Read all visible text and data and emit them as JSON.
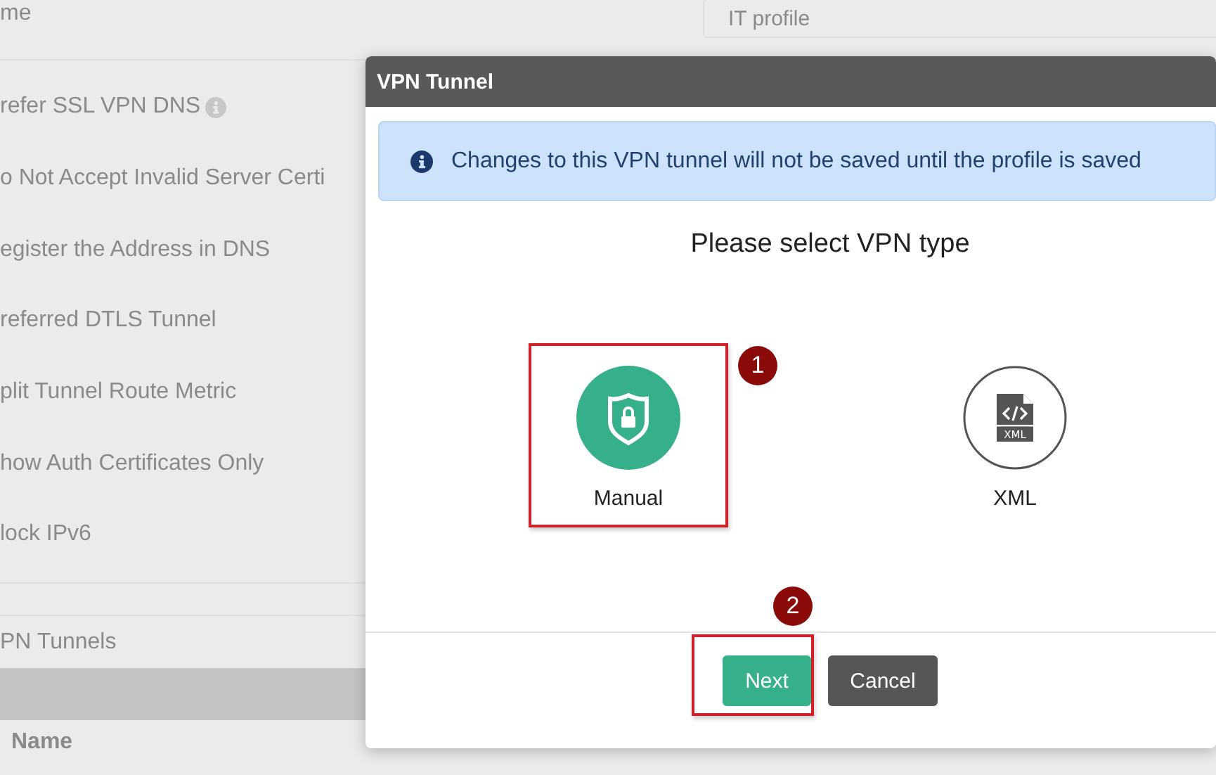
{
  "background": {
    "name_label": "me",
    "profile_field": {
      "value": "IT profile"
    },
    "settings": [
      {
        "label": "refer SSL VPN DNS",
        "info": true
      },
      {
        "label": "o Not Accept Invalid Server Certi",
        "info": false
      },
      {
        "label": "egister the Address in DNS",
        "info": false
      },
      {
        "label": "referred DTLS Tunnel",
        "info": false
      },
      {
        "label": "plit Tunnel Route Metric",
        "info": false
      },
      {
        "label": "how Auth Certificates Only",
        "info": false
      },
      {
        "label": "lock IPv6",
        "info": false
      }
    ],
    "section": "PN Tunnels",
    "table": {
      "columns": [
        "Name"
      ]
    }
  },
  "dialog": {
    "title": "VPN Tunnel",
    "alert": "Changes to this VPN tunnel will not be saved until the profile is saved",
    "heading": "Please select VPN type",
    "types": [
      {
        "kind": "shield",
        "label": "Manual",
        "highlighted": true,
        "step": "1"
      },
      {
        "kind": "xml",
        "label": "XML",
        "icon_text": "XML",
        "highlighted": false
      }
    ],
    "buttons": [
      {
        "kind": "primary",
        "label": "Next",
        "highlighted": true,
        "step": "2"
      },
      {
        "kind": "secondary",
        "label": "Cancel",
        "highlighted": false
      }
    ]
  }
}
